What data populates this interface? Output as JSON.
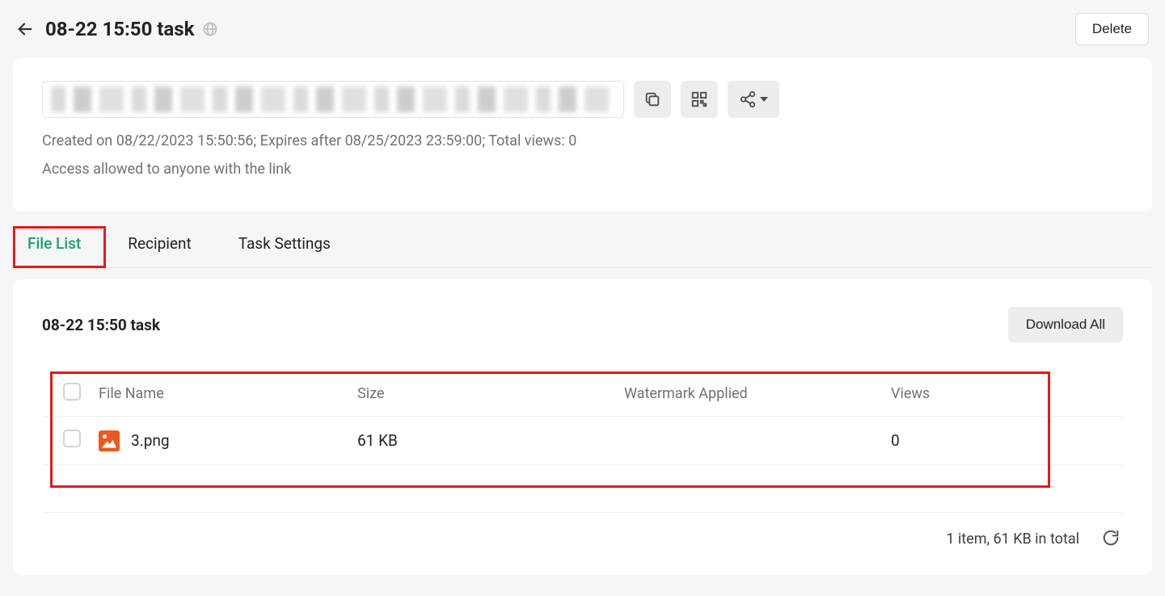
{
  "header": {
    "title": "08-22 15:50 task",
    "delete_label": "Delete"
  },
  "link_panel": {
    "created_line": "Created on 08/22/2023 15:50:56; Expires after 08/25/2023 23:59:00; Total views: 0",
    "access_line": "Access allowed to anyone with the link"
  },
  "tabs": {
    "file_list": "File List",
    "recipient": "Recipient",
    "task_settings": "Task Settings"
  },
  "content": {
    "title": "08-22 15:50 task",
    "download_all": "Download All",
    "columns": {
      "name": "File Name",
      "size": "Size",
      "watermark": "Watermark Applied",
      "views": "Views"
    },
    "rows": [
      {
        "name": "3.png",
        "size": "61 KB",
        "watermark": "",
        "views": "0"
      }
    ],
    "footer_summary": "1 item, 61 KB in total"
  }
}
